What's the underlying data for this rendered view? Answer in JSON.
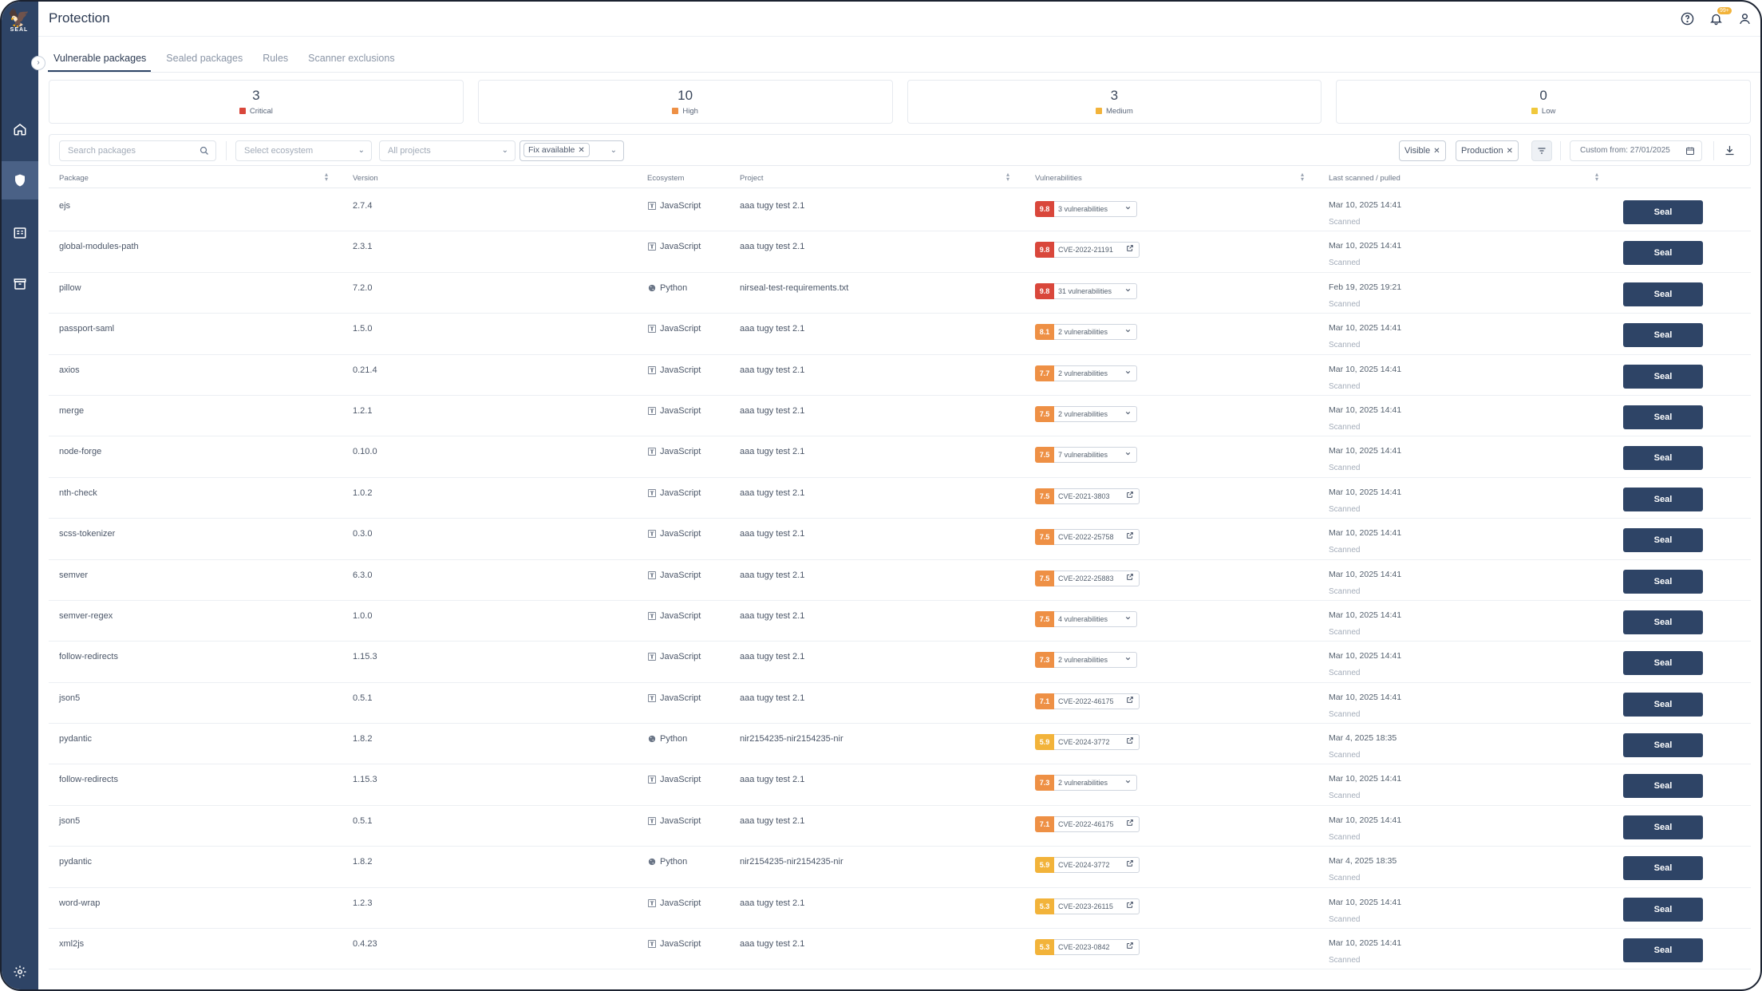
{
  "app": {
    "logo_text": "SEAL",
    "page_title": "Protection",
    "notification_count": "99+"
  },
  "tabs": [
    {
      "label": "Vulnerable packages",
      "active": true
    },
    {
      "label": "Sealed packages",
      "active": false
    },
    {
      "label": "Rules",
      "active": false
    },
    {
      "label": "Scanner exclusions",
      "active": false
    }
  ],
  "severity": [
    {
      "count": "3",
      "label": "Critical",
      "color": "#d9473b"
    },
    {
      "count": "10",
      "label": "High",
      "color": "#ee9045"
    },
    {
      "count": "3",
      "label": "Medium",
      "color": "#f2b33a"
    },
    {
      "count": "0",
      "label": "Low",
      "color": "#f0c83c"
    }
  ],
  "filters": {
    "search_placeholder": "Search packages",
    "ecosystem_placeholder": "Select ecosystem",
    "projects_placeholder": "All projects",
    "fix_chip": "Fix available",
    "visible_chip": "Visible",
    "production_chip": "Production",
    "date_range": "Custom from: 27/01/2025"
  },
  "columns": {
    "package": "Package",
    "version": "Version",
    "ecosystem": "Ecosystem",
    "project": "Project",
    "vulnerabilities": "Vulnerabilities",
    "last_scanned": "Last scanned / pulled"
  },
  "seal_label": "Seal",
  "rows": [
    {
      "package": "ejs",
      "version": "2.7.4",
      "ecosystem": "JavaScript",
      "project": "aaa tugy test 2.1",
      "score": "9.8",
      "score_color": "#d9473b",
      "vuln": "3 vulnerabilities",
      "vuln_type": "dropdown",
      "date": "Mar 10, 2025 14:41",
      "status": "Scanned"
    },
    {
      "package": "global-modules-path",
      "version": "2.3.1",
      "ecosystem": "JavaScript",
      "project": "aaa tugy test 2.1",
      "score": "9.8",
      "score_color": "#d9473b",
      "vuln": "CVE-2022-21191",
      "vuln_type": "link",
      "date": "Mar 10, 2025 14:41",
      "status": "Scanned"
    },
    {
      "package": "pillow",
      "version": "7.2.0",
      "ecosystem": "Python",
      "project": "nirseal-test-requirements.txt",
      "score": "9.8",
      "score_color": "#d9473b",
      "vuln": "31 vulnerabilities",
      "vuln_type": "dropdown",
      "date": "Feb 19, 2025 19:21",
      "status": "Scanned"
    },
    {
      "package": "passport-saml",
      "version": "1.5.0",
      "ecosystem": "JavaScript",
      "project": "aaa tugy test 2.1",
      "score": "8.1",
      "score_color": "#ee9045",
      "vuln": "2 vulnerabilities",
      "vuln_type": "dropdown",
      "date": "Mar 10, 2025 14:41",
      "status": "Scanned"
    },
    {
      "package": "axios",
      "version": "0.21.4",
      "ecosystem": "JavaScript",
      "project": "aaa tugy test 2.1",
      "score": "7.7",
      "score_color": "#ee9045",
      "vuln": "2 vulnerabilities",
      "vuln_type": "dropdown",
      "date": "Mar 10, 2025 14:41",
      "status": "Scanned"
    },
    {
      "package": "merge",
      "version": "1.2.1",
      "ecosystem": "JavaScript",
      "project": "aaa tugy test 2.1",
      "score": "7.5",
      "score_color": "#ee9045",
      "vuln": "2 vulnerabilities",
      "vuln_type": "dropdown",
      "date": "Mar 10, 2025 14:41",
      "status": "Scanned"
    },
    {
      "package": "node-forge",
      "version": "0.10.0",
      "ecosystem": "JavaScript",
      "project": "aaa tugy test 2.1",
      "score": "7.5",
      "score_color": "#ee9045",
      "vuln": "7 vulnerabilities",
      "vuln_type": "dropdown",
      "date": "Mar 10, 2025 14:41",
      "status": "Scanned"
    },
    {
      "package": "nth-check",
      "version": "1.0.2",
      "ecosystem": "JavaScript",
      "project": "aaa tugy test 2.1",
      "score": "7.5",
      "score_color": "#ee9045",
      "vuln": "CVE-2021-3803",
      "vuln_type": "link",
      "date": "Mar 10, 2025 14:41",
      "status": "Scanned"
    },
    {
      "package": "scss-tokenizer",
      "version": "0.3.0",
      "ecosystem": "JavaScript",
      "project": "aaa tugy test 2.1",
      "score": "7.5",
      "score_color": "#ee9045",
      "vuln": "CVE-2022-25758",
      "vuln_type": "link",
      "date": "Mar 10, 2025 14:41",
      "status": "Scanned"
    },
    {
      "package": "semver",
      "version": "6.3.0",
      "ecosystem": "JavaScript",
      "project": "aaa tugy test 2.1",
      "score": "7.5",
      "score_color": "#ee9045",
      "vuln": "CVE-2022-25883",
      "vuln_type": "link",
      "date": "Mar 10, 2025 14:41",
      "status": "Scanned"
    },
    {
      "package": "semver-regex",
      "version": "1.0.0",
      "ecosystem": "JavaScript",
      "project": "aaa tugy test 2.1",
      "score": "7.5",
      "score_color": "#ee9045",
      "vuln": "4 vulnerabilities",
      "vuln_type": "dropdown",
      "date": "Mar 10, 2025 14:41",
      "status": "Scanned"
    },
    {
      "package": "follow-redirects",
      "version": "1.15.3",
      "ecosystem": "JavaScript",
      "project": "aaa tugy test 2.1",
      "score": "7.3",
      "score_color": "#ee9045",
      "vuln": "2 vulnerabilities",
      "vuln_type": "dropdown",
      "date": "Mar 10, 2025 14:41",
      "status": "Scanned"
    },
    {
      "package": "json5",
      "version": "0.5.1",
      "ecosystem": "JavaScript",
      "project": "aaa tugy test 2.1",
      "score": "7.1",
      "score_color": "#ee9045",
      "vuln": "CVE-2022-46175",
      "vuln_type": "link",
      "date": "Mar 10, 2025 14:41",
      "status": "Scanned"
    },
    {
      "package": "pydantic",
      "version": "1.8.2",
      "ecosystem": "Python",
      "project": "nir2154235-nir2154235-nir",
      "score": "5.9",
      "score_color": "#f2b33a",
      "vuln": "CVE-2024-3772",
      "vuln_type": "link",
      "date": "Mar 4, 2025 18:35",
      "status": "Scanned"
    },
    {
      "package": "follow-redirects",
      "version": "1.15.3",
      "ecosystem": "JavaScript",
      "project": "aaa tugy test 2.1",
      "score": "7.3",
      "score_color": "#ee9045",
      "vuln": "2 vulnerabilities",
      "vuln_type": "dropdown",
      "date": "Mar 10, 2025 14:41",
      "status": "Scanned"
    },
    {
      "package": "json5",
      "version": "0.5.1",
      "ecosystem": "JavaScript",
      "project": "aaa tugy test 2.1",
      "score": "7.1",
      "score_color": "#ee9045",
      "vuln": "CVE-2022-46175",
      "vuln_type": "link",
      "date": "Mar 10, 2025 14:41",
      "status": "Scanned"
    },
    {
      "package": "pydantic",
      "version": "1.8.2",
      "ecosystem": "Python",
      "project": "nir2154235-nir2154235-nir",
      "score": "5.9",
      "score_color": "#f2b33a",
      "vuln": "CVE-2024-3772",
      "vuln_type": "link",
      "date": "Mar 4, 2025 18:35",
      "status": "Scanned"
    },
    {
      "package": "word-wrap",
      "version": "1.2.3",
      "ecosystem": "JavaScript",
      "project": "aaa tugy test 2.1",
      "score": "5.3",
      "score_color": "#f2b33a",
      "vuln": "CVE-2023-26115",
      "vuln_type": "link",
      "date": "Mar 10, 2025 14:41",
      "status": "Scanned"
    },
    {
      "package": "xml2js",
      "version": "0.4.23",
      "ecosystem": "JavaScript",
      "project": "aaa tugy test 2.1",
      "score": "5.3",
      "score_color": "#f2b33a",
      "vuln": "CVE-2023-0842",
      "vuln_type": "link",
      "date": "Mar 10, 2025 14:41",
      "status": "Scanned"
    }
  ]
}
